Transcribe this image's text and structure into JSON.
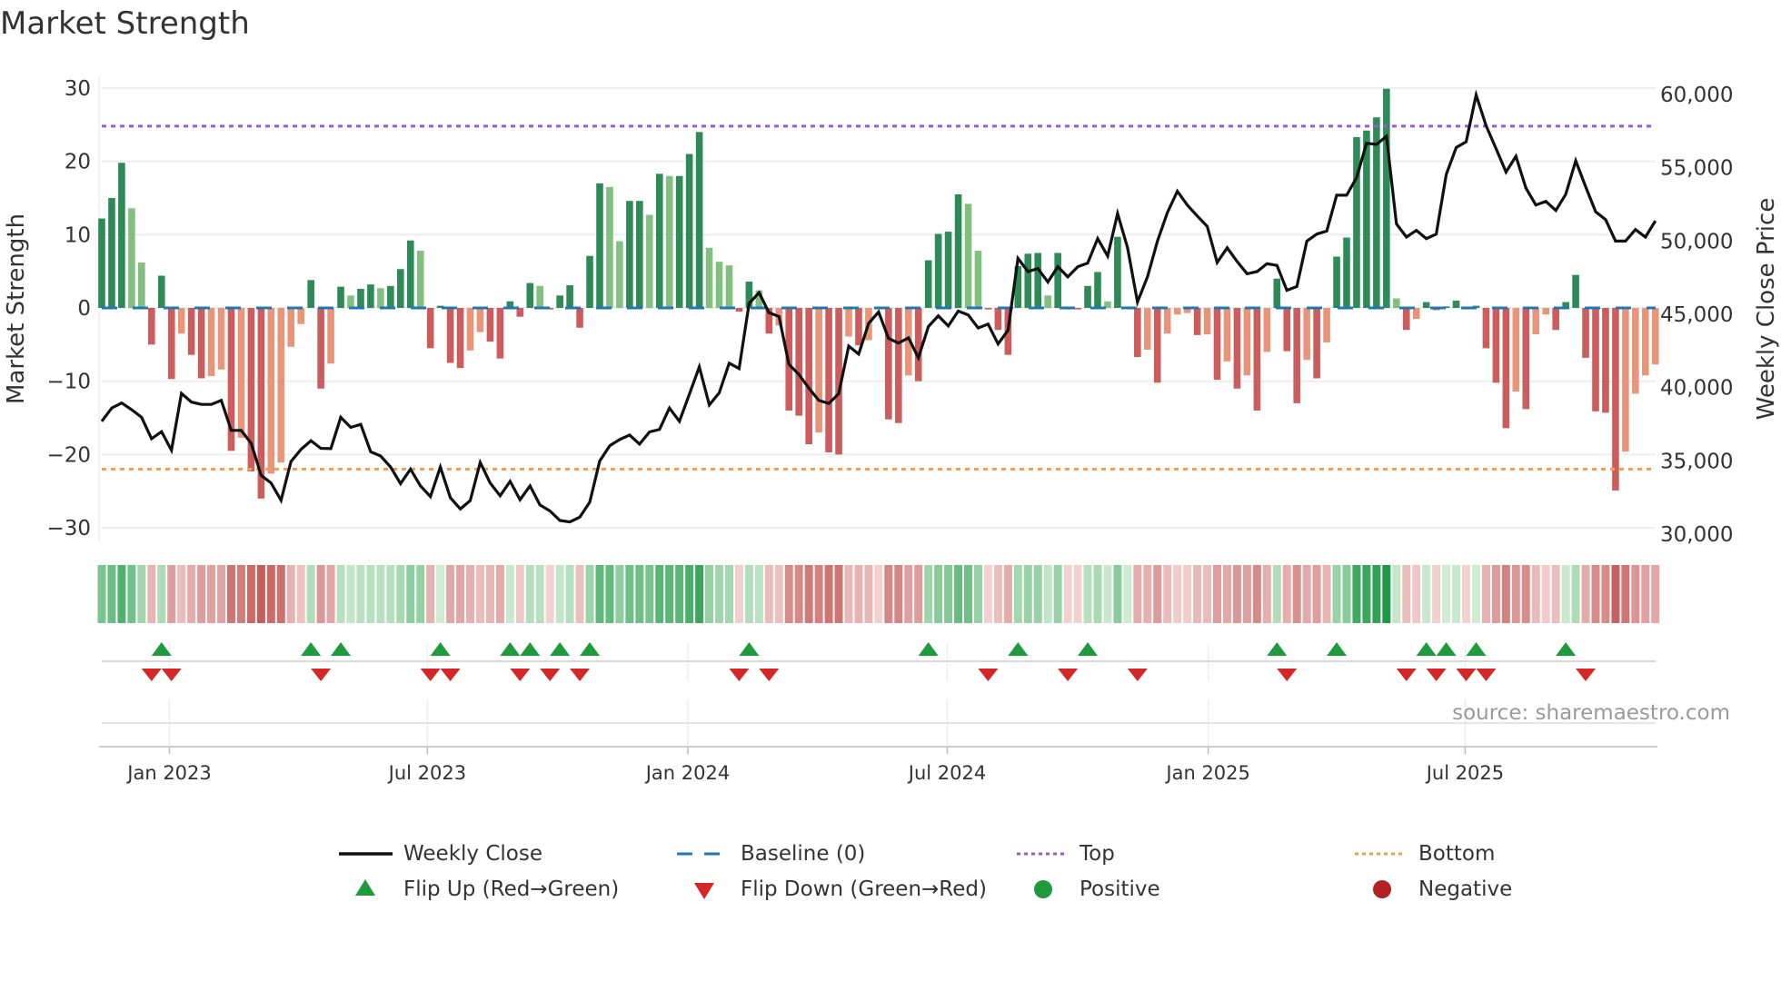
{
  "title": "Market Strength",
  "source": "source: sharemaestro.com",
  "legend": {
    "weekly_close": "Weekly Close",
    "baseline": "Baseline (0)",
    "top": "Top",
    "bottom": "Bottom",
    "flip_up": "Flip Up (Red→Green)",
    "flip_down": "Flip Down (Green→Red)",
    "positive": "Positive",
    "negative": "Negative"
  },
  "colors": {
    "pos_strong": "#2e8b57",
    "pos_weak": "#81c07f",
    "neg_strong": "#cd5c5c",
    "neg_weak": "#e8957a",
    "baseline": "#1f77b4",
    "top": "#9b59d6",
    "bottom": "#f0a050",
    "line": "#111111",
    "flip_up": "#1f9a3e",
    "flip_down": "#d62728",
    "positive_dot": "#1f9a3e",
    "negative_dot": "#b22222"
  },
  "chart_data": {
    "type": "bar",
    "title": "Market Strength",
    "ylabel": "Market Strength",
    "y2label": "Weekly Close Price",
    "interval": "weekly",
    "ylim": [
      -30,
      30
    ],
    "y2lim": [
      30000,
      60000
    ],
    "yticks": [
      30,
      20,
      10,
      0,
      -10,
      -20,
      -30
    ],
    "ytick_labels": [
      "30",
      "20",
      "10",
      "0",
      "−10",
      "−20",
      "−30"
    ],
    "y2ticks": [
      60000,
      55000,
      50000,
      45000,
      40000,
      35000,
      30000
    ],
    "y2tick_labels": [
      "60,000",
      "55,000",
      "50,000",
      "45,000",
      "40,000",
      "35,000",
      "30,000"
    ],
    "xticks": [
      {
        "label": "Jan 2023",
        "week": 6.8
      },
      {
        "label": "Jul 2023",
        "week": 32.7
      },
      {
        "label": "Jan 2024",
        "week": 58.85
      },
      {
        "label": "Jul 2024",
        "week": 84.9
      },
      {
        "label": "Jan 2025",
        "week": 111.1
      },
      {
        "label": "Jul 2025",
        "week": 136.9
      }
    ],
    "top_level": 24.8,
    "bottom_level": -22,
    "baseline": 0,
    "strength": [
      12.2,
      15,
      19.8,
      13.6,
      6.2,
      -5,
      4.4,
      -9.7,
      -3.5,
      -6.4,
      -9.6,
      -9.3,
      -8.4,
      -19.5,
      -17.7,
      -22.3,
      -26,
      -22.6,
      -21.1,
      -5.3,
      -2.2,
      3.8,
      -11,
      -7.6,
      2.9,
      1.7,
      2.6,
      3.2,
      2.7,
      3,
      5.3,
      9.2,
      7.8,
      -5.5,
      0.3,
      -7.5,
      -8.2,
      -5.8,
      -3.3,
      -4.6,
      -6.9,
      0.9,
      -1.2,
      3.4,
      3,
      -0.2,
      1.7,
      3.1,
      -2.7,
      7.1,
      17,
      16.5,
      9.1,
      14.6,
      14.6,
      12.7,
      18.3,
      18,
      18,
      21,
      24,
      8.2,
      6.3,
      5.8,
      -0.5,
      3.6,
      2.4,
      -3.5,
      -2.4,
      -14,
      -14.7,
      -18.6,
      -17,
      -19.7,
      -20,
      -3.9,
      -5.1,
      -4.4,
      -0.2,
      -15.2,
      -15.7,
      -9.2,
      -10,
      6.5,
      10.1,
      10.4,
      15.5,
      14.2,
      7.8,
      -0.2,
      -3,
      -6.4,
      5.7,
      7.4,
      7.5,
      1.7,
      7.5,
      -0.2,
      -0.2,
      3,
      4.9,
      0.9,
      9.7,
      0.2,
      -6.7,
      -5.7,
      -10.2,
      -3.5,
      -0.9,
      -0.7,
      -3.7,
      -3.6,
      -9.8,
      -7.3,
      -11,
      -9.2,
      -14,
      -6,
      4,
      -5.9,
      -13,
      -7.1,
      -9.6,
      -4.7,
      7,
      9.6,
      23.3,
      24.2,
      26,
      29.9,
      1.3,
      -3,
      -1.5,
      0.8,
      -0.3,
      0.2,
      1,
      -0.2,
      0.3,
      -5.5,
      -10.2,
      -16.4,
      -11.4,
      -13.8,
      -3.6,
      -0.9,
      -3,
      0.8,
      4.5,
      -6.8,
      -14.1,
      -14.3,
      -24.9,
      -19.6,
      -11.7,
      -9.2,
      -7.7
    ],
    "weekly_close": [
      37270,
      38170,
      38520,
      38060,
      37540,
      36080,
      36560,
      35290,
      39170,
      38580,
      38420,
      38420,
      38690,
      36650,
      36650,
      35770,
      33580,
      33060,
      31880,
      34520,
      35350,
      35940,
      35420,
      35400,
      37540,
      36850,
      37060,
      35190,
      34900,
      34150,
      33020,
      34000,
      32860,
      32130,
      34150,
      32060,
      31290,
      31860,
      34460,
      33060,
      32190,
      33170,
      31920,
      32860,
      31560,
      31150,
      30500,
      30400,
      30730,
      31750,
      34560,
      35600,
      36020,
      36330,
      35710,
      36540,
      36710,
      38170,
      37270,
      39100,
      40980,
      38380,
      39210,
      41230,
      40870,
      45310,
      46040,
      44670,
      44420,
      41150,
      40460,
      39520,
      38690,
      38480,
      39150,
      42400,
      41850,
      43940,
      44730,
      42930,
      42600,
      42960,
      41600,
      43730,
      44460,
      43770,
      44790,
      44520,
      43630,
      43900,
      42540,
      43480,
      48380,
      47480,
      47690,
      46770,
      47810,
      47120,
      47810,
      48060,
      49730,
      48540,
      51440,
      49100,
      45400,
      47120,
      49560,
      51500,
      52960,
      52020,
      51270,
      50560,
      48100,
      49100,
      48170,
      47330,
      47480,
      48020,
      47900,
      46200,
      46460,
      49560,
      50040,
      50250,
      52690,
      52690,
      53900,
      56230,
      56150,
      56710,
      50730,
      49830,
      50290,
      49730,
      50040,
      54100,
      55940,
      56330,
      59520,
      57440,
      55870,
      54270,
      55350,
      53170,
      52020,
      52270,
      51650,
      52750,
      55040,
      53270,
      51560,
      51020,
      49560,
      49560,
      50350,
      49830,
      50940
    ],
    "flip_up_weeks": [
      6,
      21,
      24,
      34,
      41,
      43,
      46,
      49,
      65,
      83,
      92,
      99,
      118,
      124,
      133,
      135,
      138,
      147
    ],
    "flip_down_weeks": [
      5,
      7,
      22,
      33,
      35,
      42,
      45,
      48,
      64,
      67,
      89,
      97,
      104,
      119,
      131,
      134,
      137,
      139,
      149
    ]
  }
}
